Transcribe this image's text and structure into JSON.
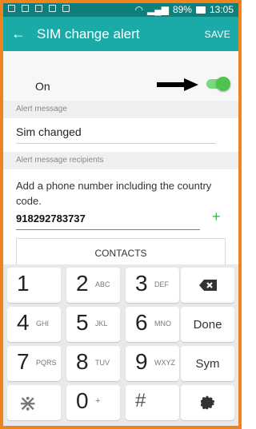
{
  "status_bar": {
    "battery": "89%",
    "time": "13:05"
  },
  "app_bar": {
    "title": "SIM change alert",
    "save_label": "SAVE",
    "back_icon": "arrow-back-icon"
  },
  "toggle_row": {
    "label": "On",
    "state": true
  },
  "alert_message": {
    "section_label": "Alert message",
    "value": "Sim changed"
  },
  "recipients": {
    "section_label": "Alert message recipients",
    "hint": "Add a phone number including the country code.",
    "phone_value": "918292783737",
    "contacts_label": "CONTACTS"
  },
  "keyboard": {
    "keys": [
      {
        "num": "1",
        "letters": ""
      },
      {
        "num": "2",
        "letters": "ABC"
      },
      {
        "num": "3",
        "letters": "DEF"
      },
      {
        "num": "4",
        "letters": "GHI"
      },
      {
        "num": "5",
        "letters": "JKL"
      },
      {
        "num": "6",
        "letters": "MNO"
      },
      {
        "num": "7",
        "letters": "PQRS"
      },
      {
        "num": "8",
        "letters": "TUV"
      },
      {
        "num": "9",
        "letters": "WXYZ"
      },
      {
        "num": "⋇",
        "letters": ""
      },
      {
        "num": "0",
        "letters": "+"
      },
      {
        "num": "#",
        "letters": ""
      }
    ],
    "done_label": "Done",
    "sym_label": "Sym"
  },
  "colors": {
    "frame": "#f0831e",
    "appbar": "#1aaba8",
    "statusbar": "#0f7f7d",
    "toggle": "#4fc24f"
  }
}
